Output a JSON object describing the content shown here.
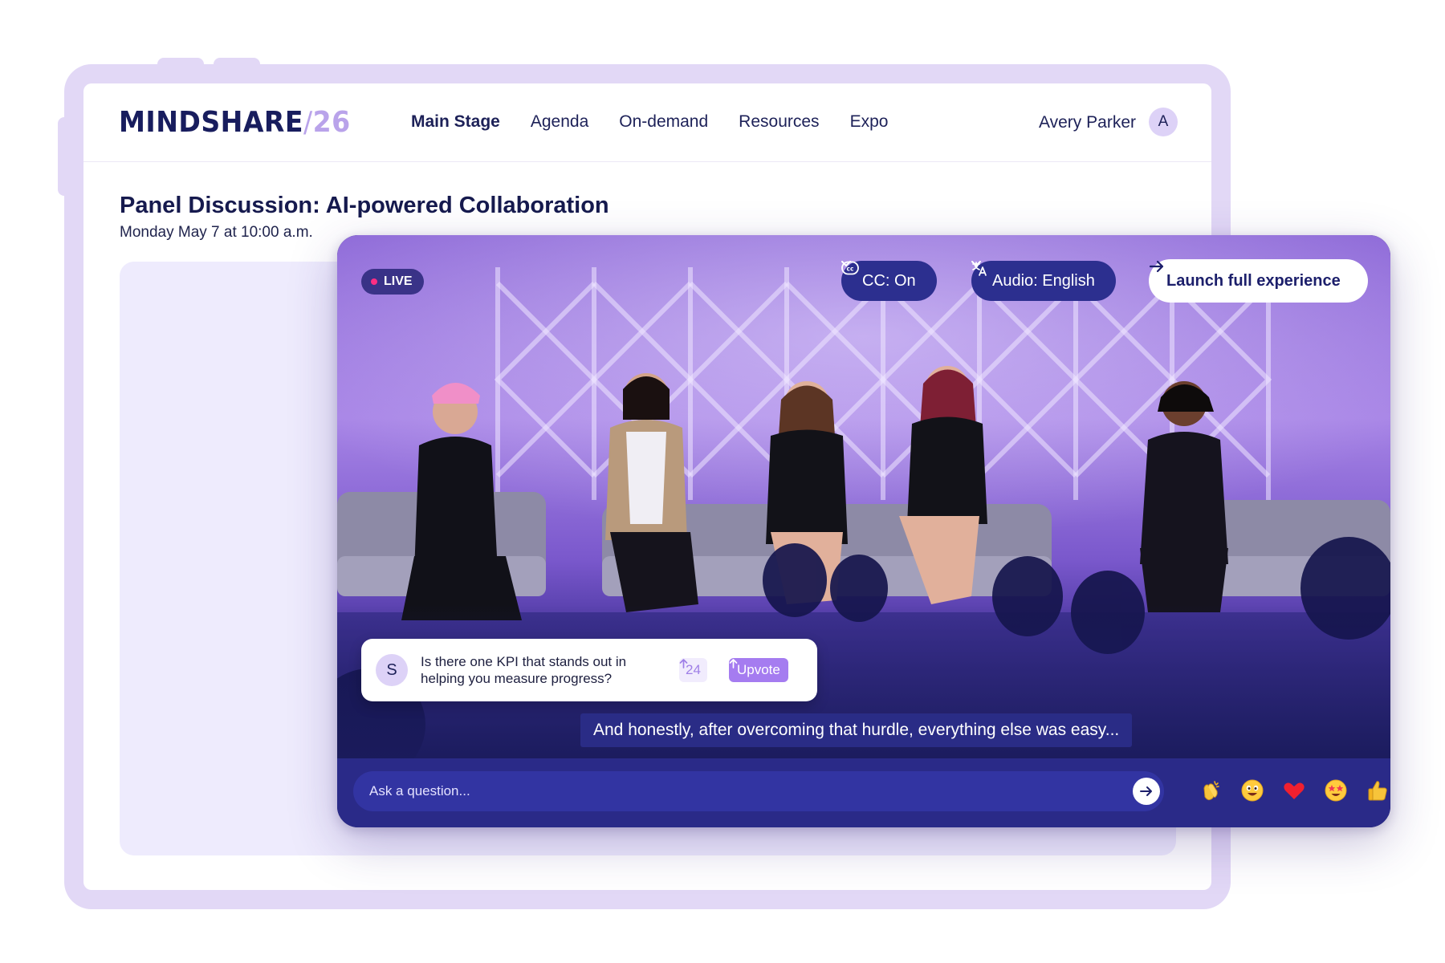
{
  "brand": {
    "name": "MINDSHARE",
    "separator": "/",
    "year": "26"
  },
  "nav": {
    "items": [
      {
        "label": "Main Stage",
        "active": true
      },
      {
        "label": "Agenda",
        "active": false
      },
      {
        "label": "On-demand",
        "active": false
      },
      {
        "label": "Resources",
        "active": false
      },
      {
        "label": "Expo",
        "active": false
      }
    ],
    "user": {
      "name": "Avery Parker",
      "initial": "A"
    }
  },
  "session": {
    "title": "Panel Discussion: AI-powered Collaboration",
    "time": "Monday May 7 at 10:00 a.m."
  },
  "player": {
    "live_label": "LIVE",
    "cc_label": "CC: On",
    "audio_label": "Audio: English",
    "launch_label": "Launch full experience",
    "question": {
      "avatar_initial": "S",
      "text": "Is there one KPI that stands out in helping you measure progress?",
      "count": "24",
      "upvote_label": "Upvote"
    },
    "caption": "And honestly, after overcoming that hurdle, everything else was easy...",
    "ask_placeholder": "Ask a question...",
    "reactions": [
      "clapping-hands",
      "grinning-face",
      "red-heart",
      "star-struck",
      "thumbs-up"
    ]
  },
  "colors": {
    "frame": "#e2d8f6",
    "brand_navy": "#181d5e",
    "brand_lavender": "#b9a3ea",
    "live_dot": "#ff2e83",
    "player_bar": "#2a2a88",
    "upvote": "#a57cf0"
  }
}
